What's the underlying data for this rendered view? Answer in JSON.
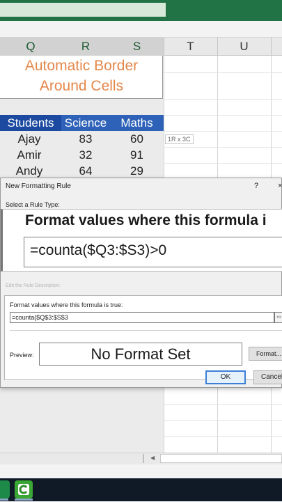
{
  "columns": {
    "q": "Q",
    "r": "R",
    "s": "S",
    "t": "T",
    "u": "U"
  },
  "sheet": {
    "title_line1": "Automatic Border",
    "title_line2": "Around Cells",
    "headers": [
      "Students",
      "Science",
      "Maths"
    ],
    "rows": [
      [
        "Ajay",
        "83",
        "60"
      ],
      [
        "Amir",
        "32",
        "91"
      ],
      [
        "Andy",
        "64",
        "29"
      ]
    ],
    "size_tooltip": "1R x 3C"
  },
  "dialog": {
    "title": "New Formatting Rule",
    "help": "?",
    "close": "×",
    "rule_type_label": "Select a Rule Type:",
    "zoom_title": "Format values where this formula i",
    "zoom_formula": "=counta($Q3:$S3)>0",
    "description_label": "Edit the Rule Description:",
    "format_values_label": "Format values where this formula is true:",
    "formula_value": "=counta($Q$3:$S$3",
    "ref_button": "▭",
    "preview_label": "Preview:",
    "preview_text": "No Format Set",
    "format_button": "Format...",
    "ok_button": "OK",
    "cancel_button": "Cancel"
  },
  "colors": {
    "excel_green": "#217346",
    "title_orange": "#e5874a",
    "header_blue": "#2e62b8",
    "ok_border": "#3c7fd6"
  },
  "icons": {
    "scroll_left": "scroll-left-arrow-icon",
    "taskbar_excel": "excel-icon",
    "taskbar_camtasia": "camtasia-icon"
  }
}
